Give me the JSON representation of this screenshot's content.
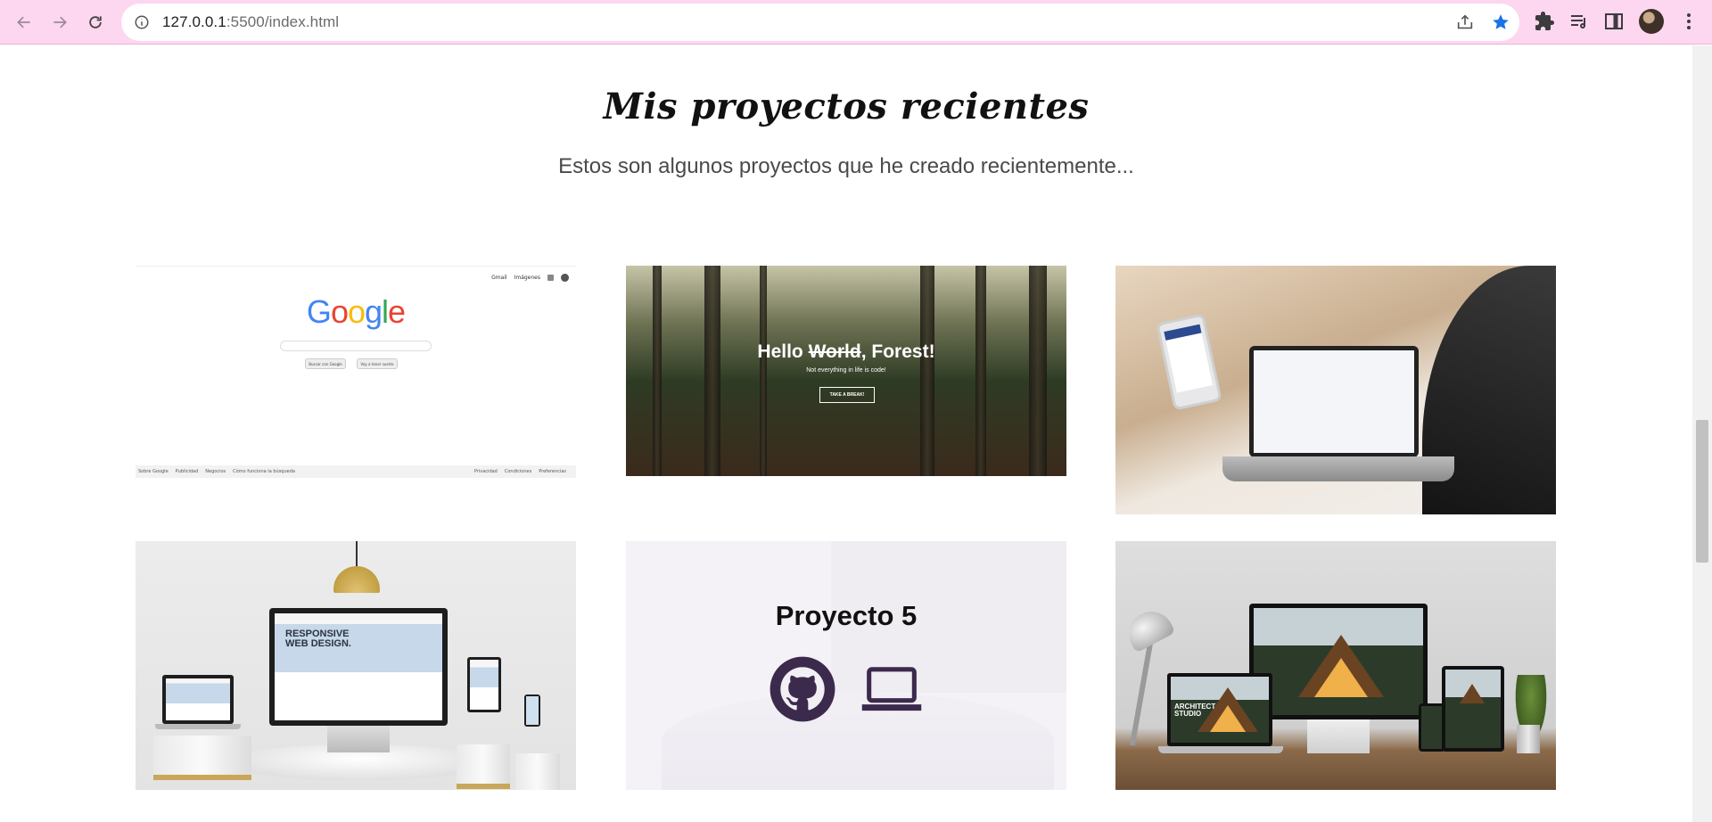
{
  "browser": {
    "url_host": "127.0.0.1",
    "url_path": ":5500/index.html"
  },
  "section": {
    "title": "Mis proyectos recientes",
    "subtitle": "Estos son algunos proyectos que he creado recientemente..."
  },
  "projects": {
    "google": {
      "top_links": [
        "Gmail",
        "Imágenes"
      ],
      "buttons": [
        "Buscar con Google",
        "Voy a tener suerte"
      ],
      "footer_left": [
        "Sobre Google",
        "Publicidad",
        "Negocios",
        "Cómo funciona la búsqueda"
      ],
      "footer_right": [
        "Privacidad",
        "Condiciones",
        "Preferencias"
      ]
    },
    "forest": {
      "hello": "Hello ",
      "struck": "World",
      "rest": ", Forest!",
      "subtitle": "Not everything in life is code!",
      "button": "TAKE A BREAK!"
    },
    "responsive": {
      "text": "RESPONSIVE WEB DESIGN."
    },
    "project5": {
      "title": "Proyecto 5"
    },
    "architect": {
      "label": "ARCHITECT STUDIO"
    }
  }
}
